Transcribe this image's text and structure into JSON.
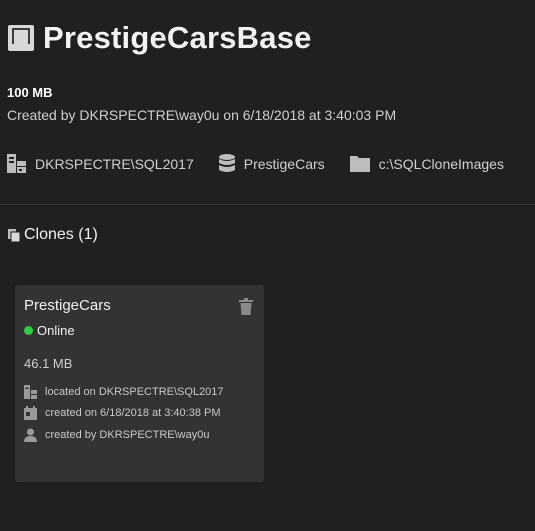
{
  "image": {
    "title": "PrestigeCarsBase",
    "size": "100 MB",
    "created_line": "Created by DKRSPECTRE\\way0u on 6/18/2018 at 3:40:03 PM",
    "server": "DKRSPECTRE\\SQL2017",
    "database": "PrestigeCars",
    "location": "c:\\SQLCloneImages"
  },
  "clones": {
    "heading": "Clones (1)",
    "items": [
      {
        "name": "PrestigeCars",
        "status": "Online",
        "size": "46.1 MB",
        "located": "located on DKRSPECTRE\\SQL2017",
        "created": "created on 6/18/2018 at 3:40:38 PM",
        "created_by": "created by DKRSPECTRE\\way0u"
      }
    ]
  },
  "colors": {
    "background": "#202020",
    "card": "#333333",
    "online": "#2ecc40"
  },
  "icons": [
    "image-icon",
    "server-icon",
    "database-icon",
    "folder-icon",
    "clones-icon",
    "trash-icon",
    "calendar-icon",
    "user-icon"
  ]
}
